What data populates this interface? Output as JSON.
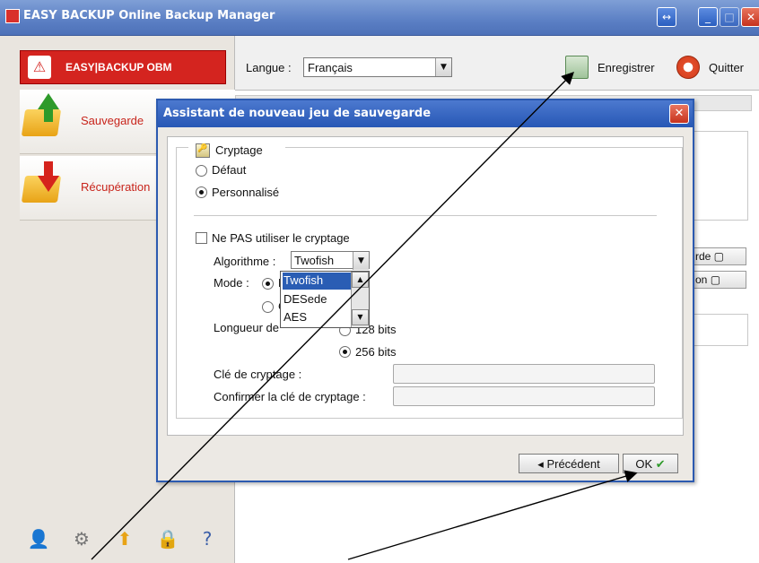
{
  "window": {
    "title": "EASY BACKUP Online Backup Manager"
  },
  "sidebar": {
    "logo_text": "EASY|BACKUP OBM",
    "items": [
      {
        "label": "Sauvegarde"
      },
      {
        "label": "Récupération"
      }
    ]
  },
  "header": {
    "language_label": "Langue :",
    "language_value": "Français",
    "save_label": "Enregistrer",
    "quit_label": "Quitter"
  },
  "main": {
    "button_1": "rde",
    "button_2": "on"
  },
  "dialog": {
    "title": "Assistant de nouveau jeu de sauvegarde",
    "section_title": "Cryptage",
    "radio_default": "Défaut",
    "radio_custom": "Personnalisé",
    "no_encryption_label": "Ne PAS utiliser le cryptage",
    "algorithm_label": "Algorithme :",
    "algorithm_value": "Twofish",
    "algorithm_options": [
      "Twofish",
      "DESede",
      "AES"
    ],
    "mode_label": "Mode :",
    "mode_ecb": "EC",
    "mode_cbc": "CE",
    "key_length_label": "Longueur de",
    "key_128": "128 bits",
    "key_256": "256 bits",
    "key_label": "Clé de cryptage :",
    "confirm_key_label": "Confirmer la clé de cryptage :",
    "back_button": "Précédent",
    "ok_button": "OK"
  },
  "colors": {
    "title_bar": "#4d71b8",
    "dialog_title_bar": "#2757b5",
    "brand_red": "#d4241f",
    "selection": "#2a5db4"
  },
  "icons": [
    "app-icon",
    "save-icon",
    "quit-icon",
    "backup-icon",
    "restore-icon",
    "user-icon",
    "gear-icon",
    "upload-icon",
    "lock-icon",
    "help-icon",
    "encryption-icon",
    "close-icon"
  ]
}
